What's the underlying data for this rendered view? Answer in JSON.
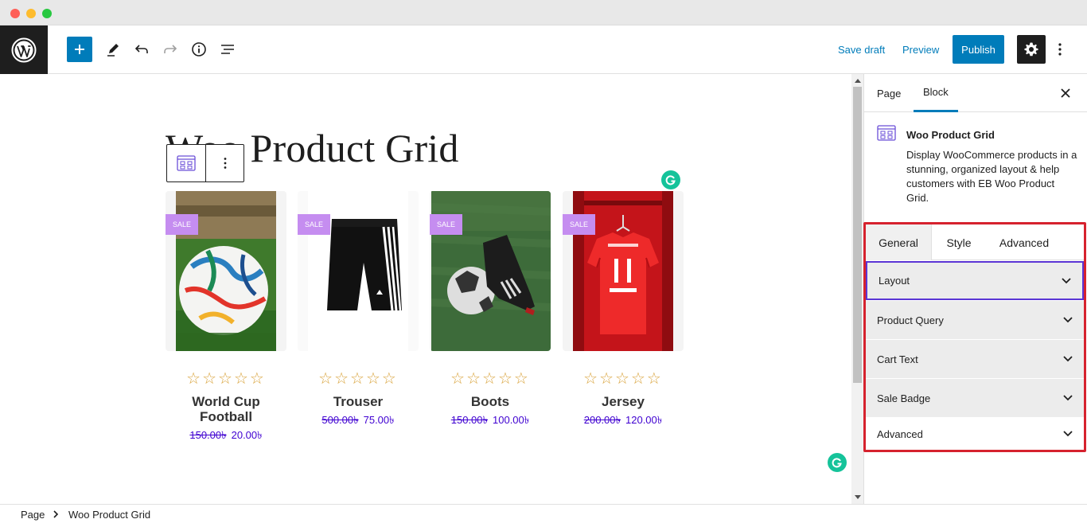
{
  "toolbar": {
    "save_draft": "Save draft",
    "preview": "Preview",
    "publish": "Publish"
  },
  "editor": {
    "page_title": "Woo Product Grid"
  },
  "products": [
    {
      "sale": "SALE",
      "name": "World Cup Football",
      "old_price": "150.00৳",
      "price": "20.00৳",
      "rating": 0
    },
    {
      "sale": "SALE",
      "name": "Trouser",
      "old_price": "500.00৳",
      "price": "75.00৳",
      "rating": 0
    },
    {
      "sale": "SALE",
      "name": "Boots",
      "old_price": "150.00৳",
      "price": "100.00৳",
      "rating": 0
    },
    {
      "sale": "SALE",
      "name": "Jersey",
      "old_price": "200.00৳",
      "price": "120.00৳",
      "rating": 0
    }
  ],
  "stars": "☆☆☆☆☆",
  "sidebar": {
    "tabs": [
      "Page",
      "Block"
    ],
    "active_tab": "Block",
    "block_name": "Woo Product Grid",
    "block_description": "Display WooCommerce products in a stunning, organized layout & help customers with EB Woo Product Grid.",
    "panel_tabs": [
      "General",
      "Style",
      "Advanced"
    ],
    "active_panel_tab": "General",
    "sections": [
      "Layout",
      "Product Query",
      "Cart Text",
      "Sale Badge",
      "Advanced"
    ]
  },
  "breadcrumb": [
    "Page",
    "Woo Product Grid"
  ],
  "colors": {
    "accent": "#007cba",
    "sale_badge": "#c58df0",
    "price": "#3f00d1",
    "stars": "#d9a33b",
    "highlight": "#d6222e"
  }
}
